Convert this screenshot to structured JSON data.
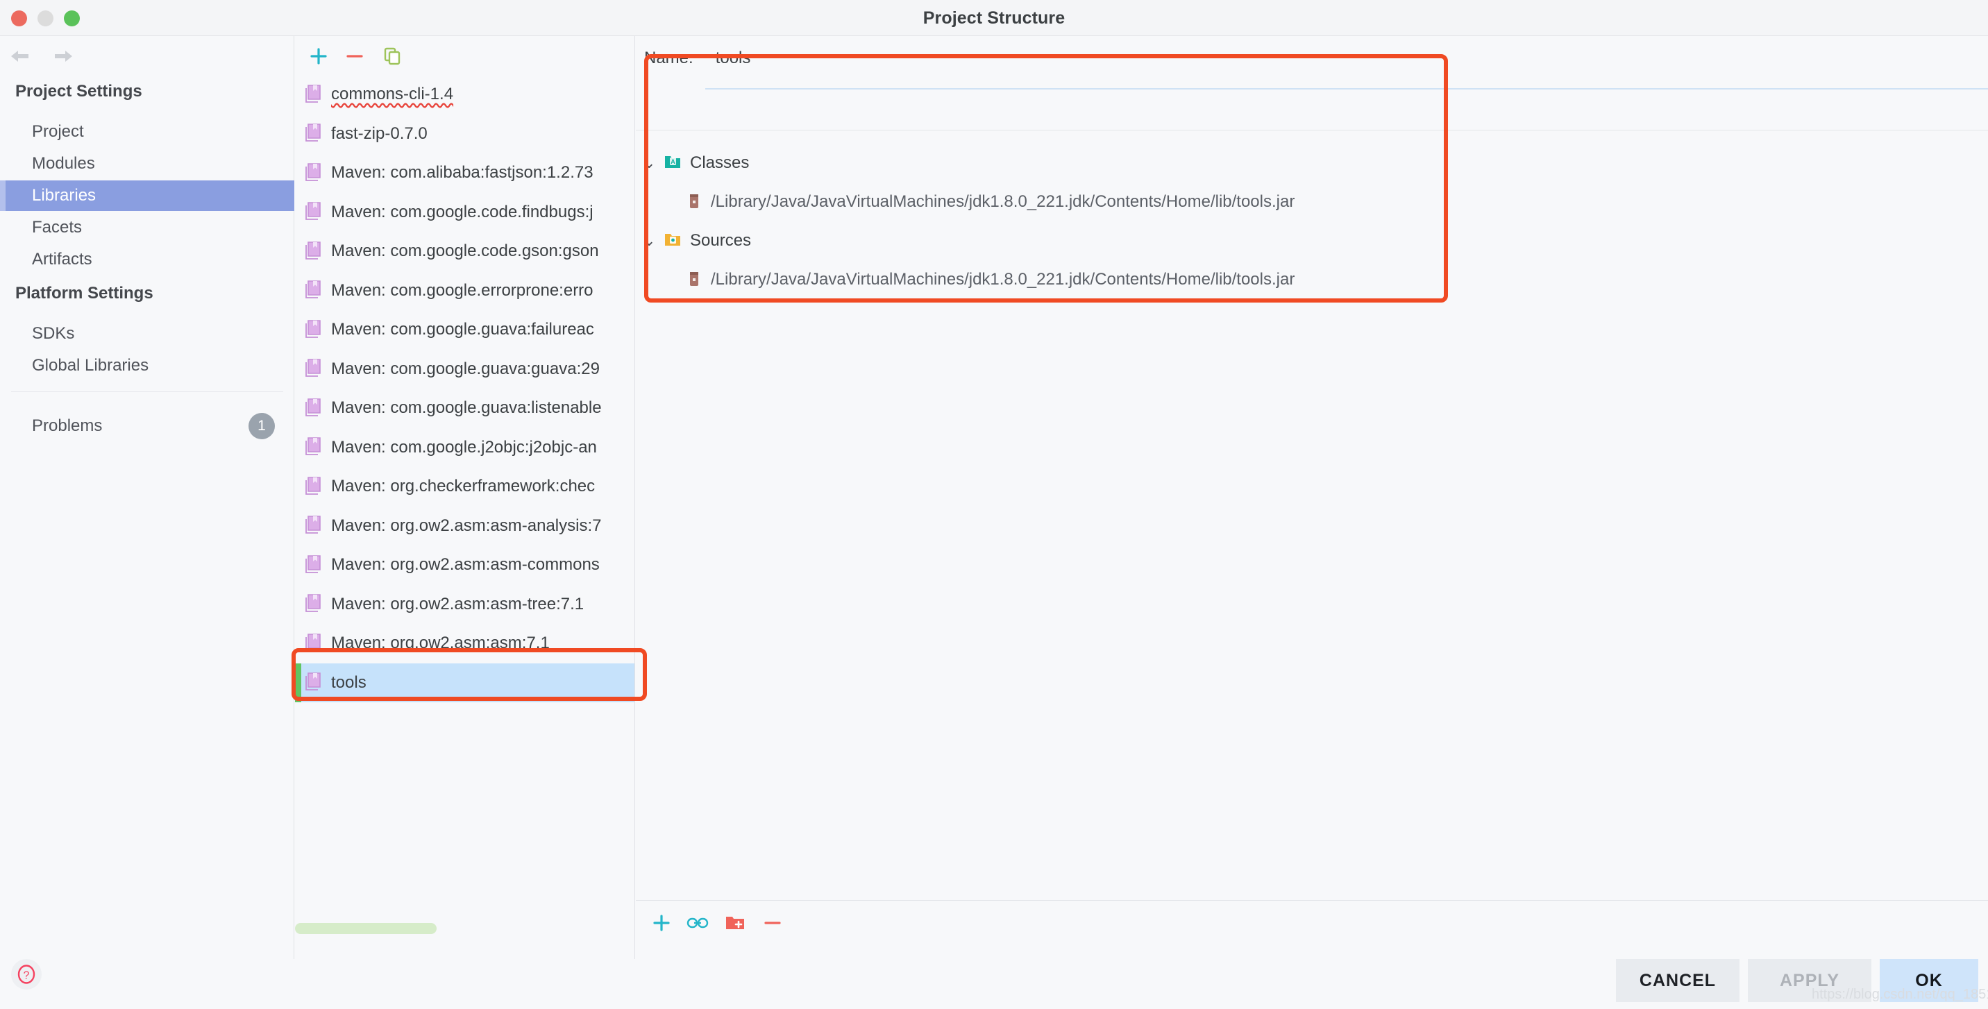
{
  "window": {
    "title": "Project Structure",
    "traffic_lights": [
      "close",
      "minimize",
      "zoom"
    ]
  },
  "sidebar": {
    "nav": {
      "back_icon": "back-arrow-icon",
      "forward_icon": "forward-arrow-icon"
    },
    "groups": [
      {
        "title": "Project Settings",
        "items": [
          {
            "label": "Project",
            "selected": false
          },
          {
            "label": "Modules",
            "selected": false
          },
          {
            "label": "Libraries",
            "selected": true
          },
          {
            "label": "Facets",
            "selected": false
          },
          {
            "label": "Artifacts",
            "selected": false
          }
        ]
      },
      {
        "title": "Platform Settings",
        "items": [
          {
            "label": "SDKs",
            "selected": false
          },
          {
            "label": "Global Libraries",
            "selected": false
          }
        ]
      }
    ],
    "problems": {
      "label": "Problems",
      "count": "1"
    },
    "help_icon": "help-question-icon"
  },
  "library_list": {
    "toolbar": [
      {
        "icon": "plus-icon",
        "name": "add-library-button"
      },
      {
        "icon": "minus-icon",
        "name": "remove-library-button"
      },
      {
        "icon": "copy-icon",
        "name": "copy-library-button"
      }
    ],
    "items": [
      {
        "label": "commons-cli-1.4",
        "selected": false,
        "misspelled": true
      },
      {
        "label": "fast-zip-0.7.0",
        "selected": false,
        "misspelled": false
      },
      {
        "label": "Maven: com.alibaba:fastjson:1.2.73",
        "selected": false,
        "misspelled": false
      },
      {
        "label": "Maven: com.google.code.findbugs:j",
        "selected": false,
        "misspelled": false
      },
      {
        "label": "Maven: com.google.code.gson:gson",
        "selected": false,
        "misspelled": false
      },
      {
        "label": "Maven: com.google.errorprone:erro",
        "selected": false,
        "misspelled": false
      },
      {
        "label": "Maven: com.google.guava:failureac",
        "selected": false,
        "misspelled": false
      },
      {
        "label": "Maven: com.google.guava:guava:29",
        "selected": false,
        "misspelled": false
      },
      {
        "label": "Maven: com.google.guava:listenable",
        "selected": false,
        "misspelled": false
      },
      {
        "label": "Maven: com.google.j2objc:j2objc-an",
        "selected": false,
        "misspelled": false
      },
      {
        "label": "Maven: org.checkerframework:chec",
        "selected": false,
        "misspelled": false
      },
      {
        "label": "Maven: org.ow2.asm:asm-analysis:7",
        "selected": false,
        "misspelled": false
      },
      {
        "label": "Maven: org.ow2.asm:asm-commons",
        "selected": false,
        "misspelled": false
      },
      {
        "label": "Maven: org.ow2.asm:asm-tree:7.1",
        "selected": false,
        "misspelled": false
      },
      {
        "label": "Maven: org.ow2.asm:asm:7.1",
        "selected": false,
        "misspelled": false
      },
      {
        "label": "tools",
        "selected": true,
        "misspelled": false
      }
    ]
  },
  "detail": {
    "name_label": "Name:",
    "name_value": "tools",
    "tree": [
      {
        "label": "Classes",
        "icon": "classes-folder-icon",
        "expanded": true,
        "chevron": "⌄",
        "children": [
          {
            "path": "/Library/Java/JavaVirtualMachines/jdk1.8.0_221.jdk/Contents/Home/lib/tools.jar",
            "icon": "jar-file-icon"
          }
        ]
      },
      {
        "label": "Sources",
        "icon": "sources-folder-icon",
        "expanded": true,
        "chevron": "⌄",
        "children": [
          {
            "path": "/Library/Java/JavaVirtualMachines/jdk1.8.0_221.jdk/Contents/Home/lib/tools.jar",
            "icon": "jar-file-icon"
          }
        ]
      }
    ],
    "toolbar": [
      {
        "icon": "plus-icon",
        "name": "add-root-button"
      },
      {
        "icon": "link-icon",
        "name": "attach-url-button"
      },
      {
        "icon": "add-folder-icon",
        "name": "add-folder-button"
      },
      {
        "icon": "minus-icon",
        "name": "remove-root-button"
      }
    ]
  },
  "footer": {
    "cancel": "CANCEL",
    "apply": "APPLY",
    "ok": "OK",
    "watermark": "https://blog.csdn.net/qq_18515155"
  },
  "colors": {
    "selection_blue": "#8a9ee0",
    "list_selection": "#c6e2fb",
    "accent_green": "#62c462",
    "annotation_red": "#f04a23",
    "ok_button": "#cfe4fa",
    "library_icon": "#d09fdd"
  }
}
